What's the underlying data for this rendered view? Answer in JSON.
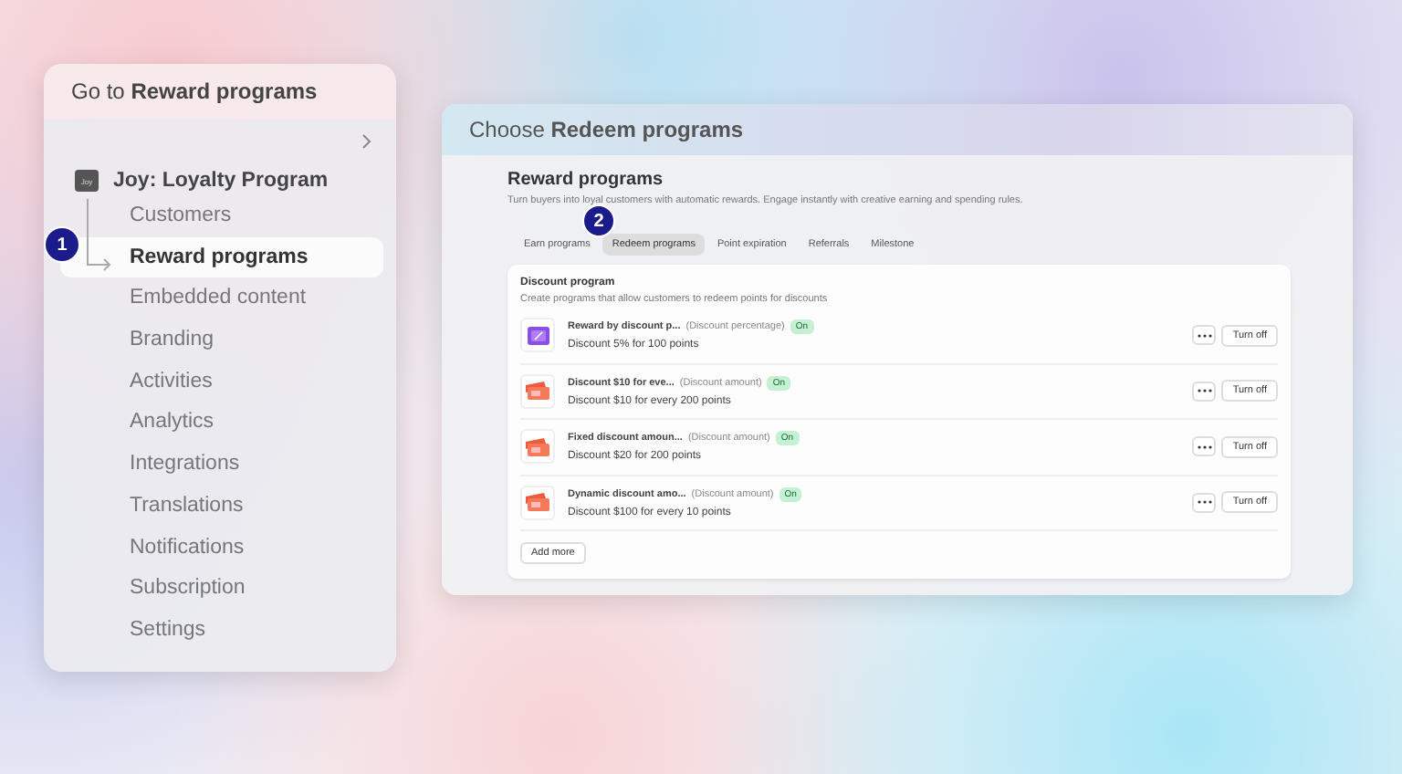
{
  "nav_panel": {
    "title": "Go to **Reward programs**",
    "app": {
      "icon_text": "Joy",
      "name": "Joy: Loyalty Program"
    },
    "items": [
      {
        "label": "Customers",
        "selected": false
      },
      {
        "label": "Reward programs",
        "selected": true
      },
      {
        "label": "Embedded content",
        "selected": false
      },
      {
        "label": "Branding",
        "selected": false
      },
      {
        "label": "Activities",
        "selected": false
      },
      {
        "label": "Analytics",
        "selected": false
      },
      {
        "label": "Integrations",
        "selected": false
      },
      {
        "label": "Translations",
        "selected": false
      },
      {
        "label": "Notifications",
        "selected": false
      },
      {
        "label": "Subscription",
        "selected": false
      },
      {
        "label": "Settings",
        "selected": false
      }
    ],
    "step": "1"
  },
  "main_panel": {
    "title": "Choose **Redeem programs**",
    "heading": "Reward programs",
    "subtitle": "Turn buyers into loyal customers with automatic rewards. Engage instantly with creative earning and spending rules.",
    "step": "2",
    "tabs": [
      {
        "label": "Earn programs",
        "selected": false
      },
      {
        "label": "Redeem programs",
        "selected": true
      },
      {
        "label": "Point expiration",
        "selected": false
      },
      {
        "label": "Referrals",
        "selected": false
      },
      {
        "label": "Milestone",
        "selected": false
      }
    ],
    "card": {
      "title": "Discount program",
      "subtitle": "Create programs that allow customers to redeem points for discounts",
      "rows": [
        {
          "kind": "percentage",
          "name": "Reward by discount p...",
          "type": "(Discount percentage)",
          "status": "On",
          "description": "Discount 5% for 100 points",
          "action": "Turn off"
        },
        {
          "kind": "amount",
          "name": "Discount $10 for eve...",
          "type": "(Discount amount)",
          "status": "On",
          "description": "Discount $10 for every 200 points",
          "action": "Turn off"
        },
        {
          "kind": "amount",
          "name": "Fixed discount amoun...",
          "type": "(Discount amount)",
          "status": "On",
          "description": "Discount $20 for 200 points",
          "action": "Turn off"
        },
        {
          "kind": "amount",
          "name": "Dynamic discount amo...",
          "type": "(Discount amount)",
          "status": "On",
          "description": "Discount $100 for every 10 points",
          "action": "Turn off"
        }
      ],
      "add_button": "Add more"
    }
  }
}
